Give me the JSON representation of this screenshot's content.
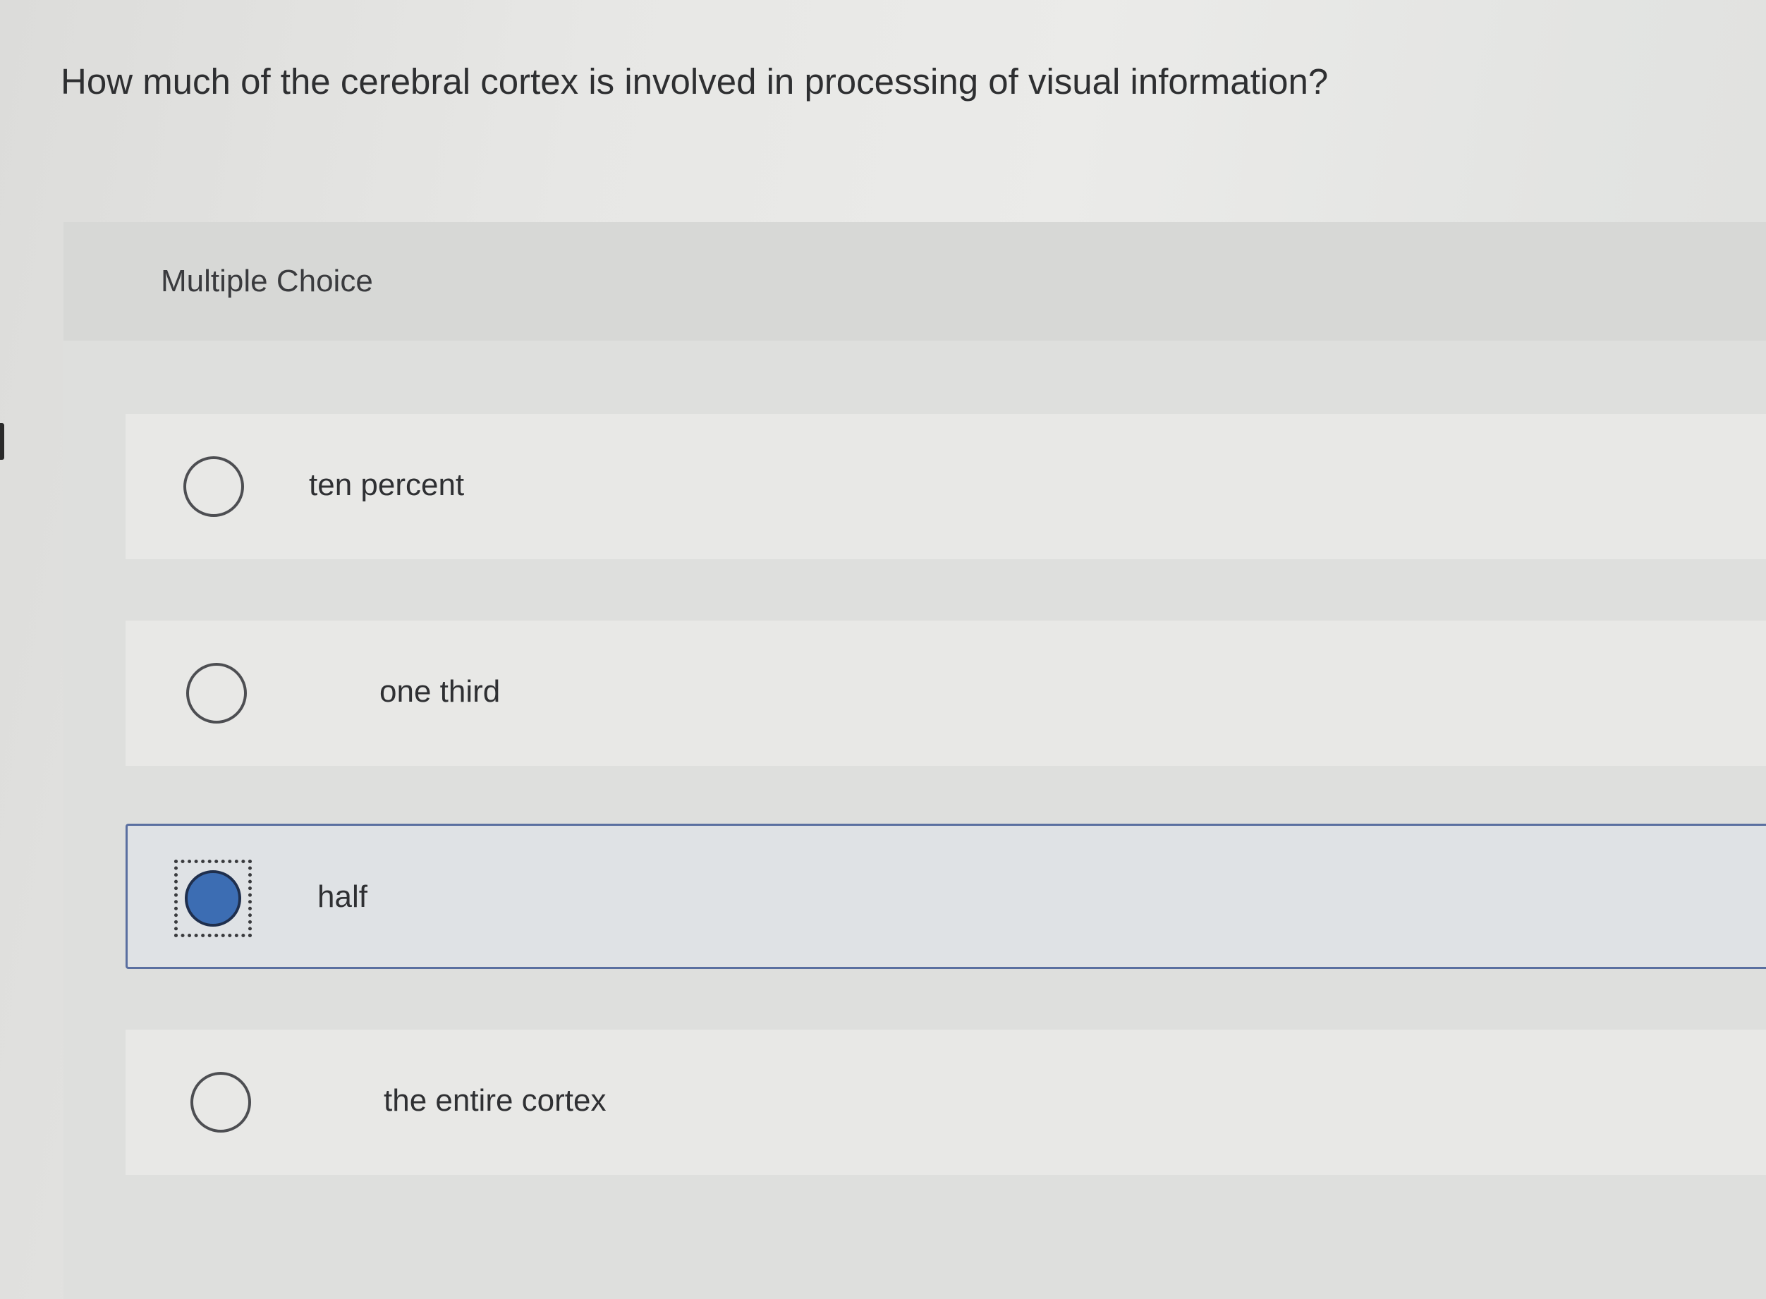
{
  "question": {
    "text": "How much of the cerebral cortex is involved in processing of visual information?"
  },
  "panel": {
    "title": "Multiple Choice"
  },
  "options": [
    {
      "label": "ten percent",
      "selected": false
    },
    {
      "label": "one third",
      "selected": false
    },
    {
      "label": "half",
      "selected": true
    },
    {
      "label": "the entire cortex",
      "selected": false
    }
  ],
  "colors": {
    "selected_radio": "#3c6db3",
    "selected_border": "#5a6fa0"
  }
}
